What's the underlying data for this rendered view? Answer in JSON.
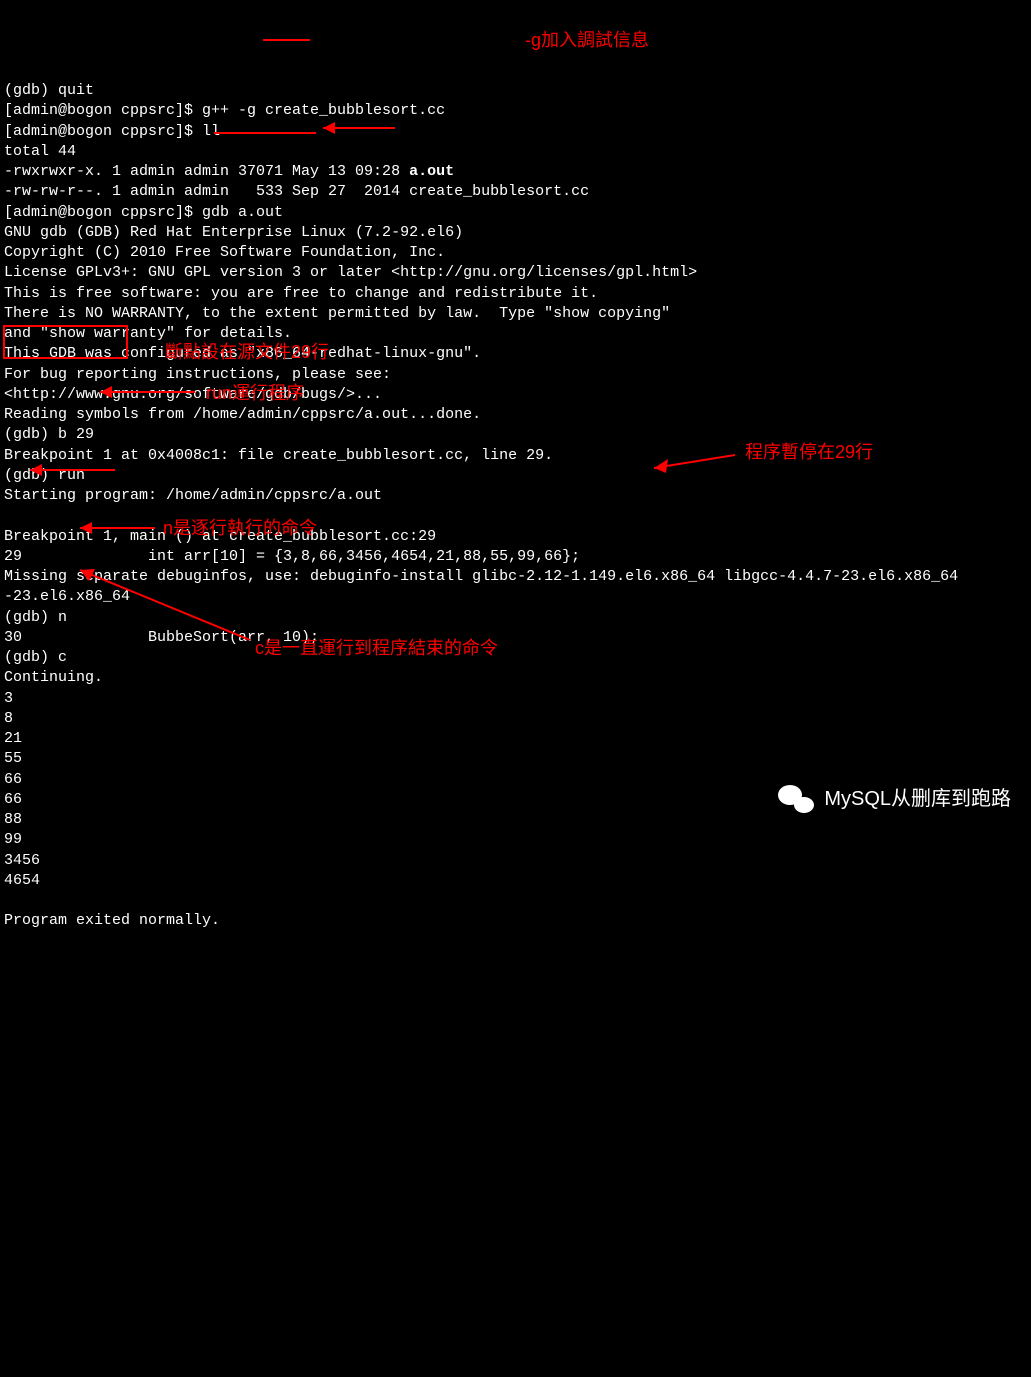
{
  "terminal": {
    "lines": [
      {
        "text": "(gdb) quit"
      },
      {
        "text": "[admin@bogon cppsrc]$ g++ -g create_bubblesort.cc"
      },
      {
        "text": "[admin@bogon cppsrc]$ ll"
      },
      {
        "text": "total 44"
      },
      {
        "prefix": "-rwxrwxr-x. 1 admin admin 37071 May 13 09:28 ",
        "bold": "a.out"
      },
      {
        "text": "-rw-rw-r--. 1 admin admin   533 Sep 27  2014 create_bubblesort.cc"
      },
      {
        "text": "[admin@bogon cppsrc]$ gdb a.out"
      },
      {
        "text": "GNU gdb (GDB) Red Hat Enterprise Linux (7.2-92.el6)"
      },
      {
        "text": "Copyright (C) 2010 Free Software Foundation, Inc."
      },
      {
        "text": "License GPLv3+: GNU GPL version 3 or later <http://gnu.org/licenses/gpl.html>"
      },
      {
        "text": "This is free software: you are free to change and redistribute it."
      },
      {
        "text": "There is NO WARRANTY, to the extent permitted by law.  Type \"show copying\""
      },
      {
        "text": "and \"show warranty\" for details."
      },
      {
        "text": "This GDB was configured as \"x86_64-redhat-linux-gnu\"."
      },
      {
        "text": "For bug reporting instructions, please see:"
      },
      {
        "text": "<http://www.gnu.org/software/gdb/bugs/>..."
      },
      {
        "text": "Reading symbols from /home/admin/cppsrc/a.out...done."
      },
      {
        "text": "(gdb) b 29"
      },
      {
        "text": "Breakpoint 1 at 0x4008c1: file create_bubblesort.cc, line 29."
      },
      {
        "text": "(gdb) run"
      },
      {
        "text": "Starting program: /home/admin/cppsrc/a.out"
      },
      {
        "text": ""
      },
      {
        "text": "Breakpoint 1, main () at create_bubblesort.cc:29"
      },
      {
        "text": "29              int arr[10] = {3,8,66,3456,4654,21,88,55,99,66};"
      },
      {
        "text": "Missing separate debuginfos, use: debuginfo-install glibc-2.12-1.149.el6.x86_64 libgcc-4.4.7-23.el6.x86_64"
      },
      {
        "text": "-23.el6.x86_64"
      },
      {
        "text": "(gdb) n"
      },
      {
        "text": "30              BubbeSort(arr, 10);"
      },
      {
        "text": "(gdb) c"
      },
      {
        "text": "Continuing."
      },
      {
        "text": "3"
      },
      {
        "text": "8"
      },
      {
        "text": "21"
      },
      {
        "text": "55"
      },
      {
        "text": "66"
      },
      {
        "text": "66"
      },
      {
        "text": "88"
      },
      {
        "text": "99"
      },
      {
        "text": "3456"
      },
      {
        "text": "4654"
      },
      {
        "text": ""
      },
      {
        "text": "Program exited normally."
      }
    ]
  },
  "annotations": {
    "g_flag": "-g加入調試信息",
    "breakpoint": "斷點設在源文件29行",
    "run": "run運行程序",
    "pause29": "程序暫停在29行",
    "n_cmd": "n是逐行執行的命令",
    "c_cmd": "c是一直運行到程序結束的命令"
  },
  "watermark": {
    "text": "MySQL从删库到跑路"
  }
}
